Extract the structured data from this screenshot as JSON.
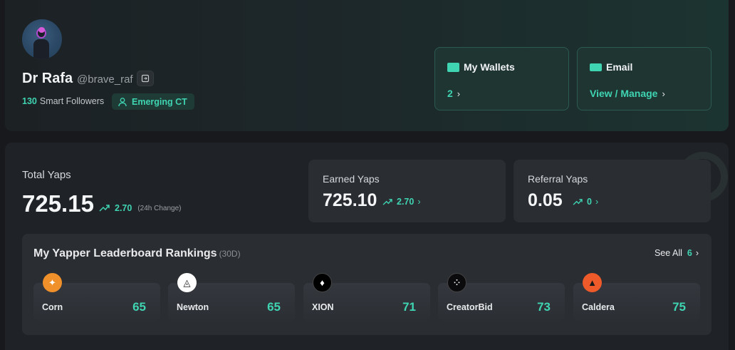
{
  "profile": {
    "name": "Dr Rafa",
    "handle": "@brave_raf",
    "followers_count": "130",
    "followers_label": "Smart Followers",
    "badge_label": "Emerging CT"
  },
  "wallets": {
    "title": "My Wallets",
    "value": "2",
    "icon": "wallet-icon"
  },
  "email": {
    "title": "Email",
    "value": "View / Manage",
    "icon": "mail-icon"
  },
  "total_yaps": {
    "label": "Total Yaps",
    "value": "725.15",
    "change": "2.70",
    "change_note": "(24h Change)"
  },
  "earned_yaps": {
    "label": "Earned Yaps",
    "value": "725.10",
    "change": "2.70"
  },
  "referral_yaps": {
    "label": "Referral Yaps",
    "value": "0.05",
    "change": "0"
  },
  "leaderboard": {
    "title": "My Yapper Leaderboard Rankings",
    "period": "(30D)",
    "see_all_label": "See All",
    "see_all_count": "6",
    "items": [
      {
        "name": "Corn",
        "rank": "65",
        "icon": "corn-icon",
        "color": "#f0902a"
      },
      {
        "name": "Newton",
        "rank": "65",
        "icon": "newton-icon",
        "color": "#ffffff"
      },
      {
        "name": "XION",
        "rank": "71",
        "icon": "xion-icon",
        "color": "#000000"
      },
      {
        "name": "CreatorBid",
        "rank": "73",
        "icon": "creatorbid-icon",
        "color": "#0b0b0e"
      },
      {
        "name": "Caldera",
        "rank": "75",
        "icon": "caldera-icon",
        "color": "#ef5a2a"
      }
    ]
  },
  "colors": {
    "accent": "#3fd4b2",
    "background": "#17191d",
    "panel": "#2a2d32"
  }
}
